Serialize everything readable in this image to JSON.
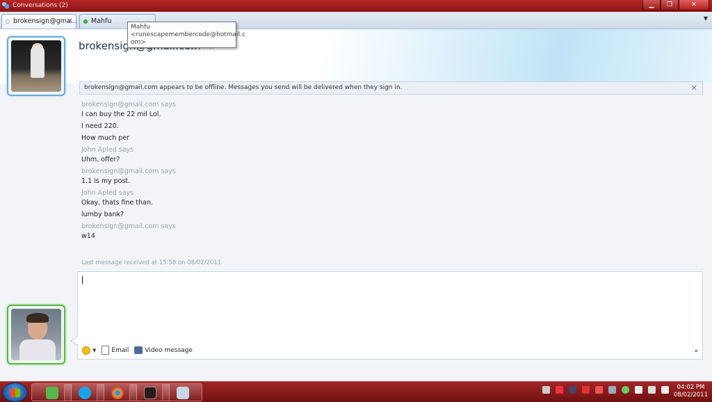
{
  "window": {
    "title": "Conversations (2)",
    "controls": {
      "minimize": "▁",
      "maximize": "❐",
      "close": "✕"
    }
  },
  "tabs": [
    {
      "label": "brokensign@gma...",
      "close": "✕",
      "status_color": "#ffffff"
    },
    {
      "label": "Mahfu",
      "status_color": "#3ec43e"
    }
  ],
  "tab_menu": "▼",
  "tooltip": {
    "line1": "Mahfu",
    "line2": "<runescapemembercode@hotmail.c",
    "line3": "om>"
  },
  "contact": {
    "name": "brokensign@gmail.com",
    "status": "(Offline)"
  },
  "notice": {
    "text": "brokensign@gmail.com appears to be offline. Messages you send will be delivered when they sign in.",
    "close": "✕"
  },
  "conversation": [
    {
      "sender": "brokensign@gmail.com says",
      "messages": [
        "I can buy the 22 mil Lol.",
        "I need 220.",
        "How much per"
      ]
    },
    {
      "sender": "John Apled says",
      "messages": [
        "Uhm, offer?"
      ]
    },
    {
      "sender": "brokensign@gmail.com says",
      "messages": [
        "1.1 is my post."
      ]
    },
    {
      "sender": "John Apled says",
      "messages": [
        "Okay, thats fine than.",
        "lumby bank?"
      ]
    },
    {
      "sender": "brokensign@gmail.com says",
      "messages": [
        "w14"
      ]
    }
  ],
  "last_received": "Last message received at 15:58 on 08/02/2011.",
  "compose": {
    "value": "",
    "toolbar": {
      "email": "Email",
      "video": "Video message",
      "more": "»"
    }
  },
  "taskbar": {
    "time": "04:02 PM",
    "date": "08/02/2011",
    "apps": [
      {
        "name": "messenger",
        "color": "#57b84a"
      },
      {
        "name": "skype",
        "color": "#1aa3e8"
      },
      {
        "name": "chrome",
        "color": "#e0b21a"
      },
      {
        "name": "game",
        "color": "#2b1a1a"
      },
      {
        "name": "calculator",
        "color": "#c8d6e6"
      }
    ]
  }
}
